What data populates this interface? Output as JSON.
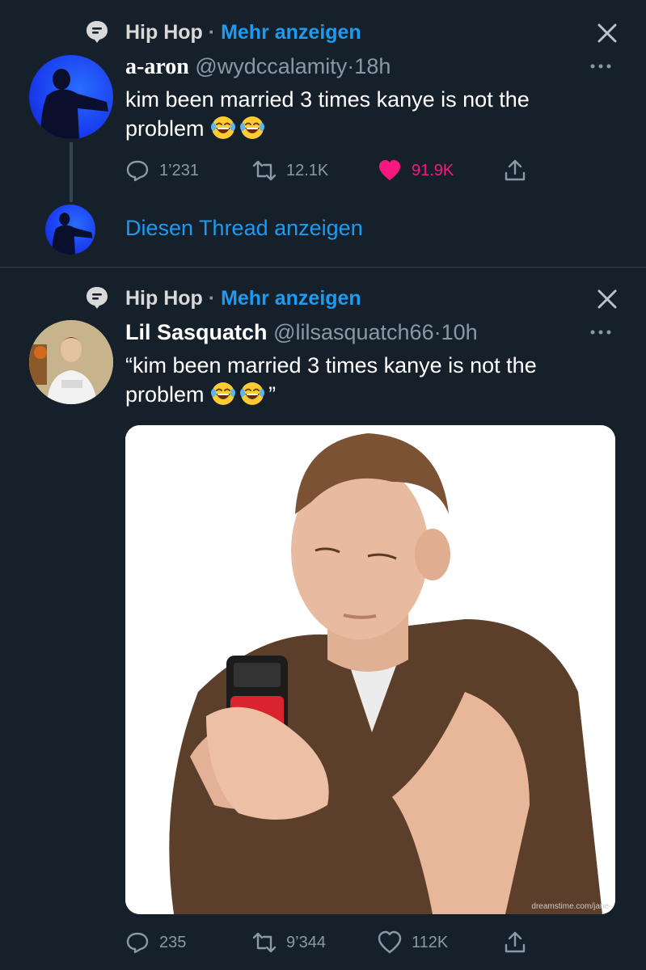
{
  "tweet1": {
    "topic": {
      "name": "Hip Hop",
      "dot": "·",
      "more": "Mehr anzeigen"
    },
    "display_name": "a-aron",
    "handle": "@wydccalamity",
    "sep": "·",
    "time": "18h",
    "text": "kim been married 3 times kanye is not the problem",
    "actions": {
      "replies": "1’231",
      "retweets": "12.1K",
      "likes": "91.9K"
    },
    "like_color": "#f91880",
    "show_thread": "Diesen Thread anzeigen"
  },
  "tweet2": {
    "topic": {
      "name": "Hip Hop",
      "dot": "·",
      "more": "Mehr anzeigen"
    },
    "display_name": "Lil Sasquatch",
    "handle": "@lilsasquatch66",
    "sep": "·",
    "time": "10h",
    "text_open_quote": "“kim been married 3 times kanye is not the",
    "text_line2": "problem",
    "text_close_quote": "”",
    "media_watermark": "dreamstime.com/jane",
    "actions": {
      "replies": "235",
      "retweets": "9’344",
      "likes": "112K"
    }
  },
  "icons": {
    "topic": "topic-icon",
    "close": "close-icon",
    "more": "more-icon",
    "reply": "reply-icon",
    "retweet": "retweet-icon",
    "like": "heart-icon",
    "share": "share-icon",
    "emoji": "laughing-tears-emoji"
  },
  "colors": {
    "background": "#15202b",
    "accent": "#1d9bf0",
    "secondary_text": "#8b98a5",
    "divider": "#38444d"
  }
}
